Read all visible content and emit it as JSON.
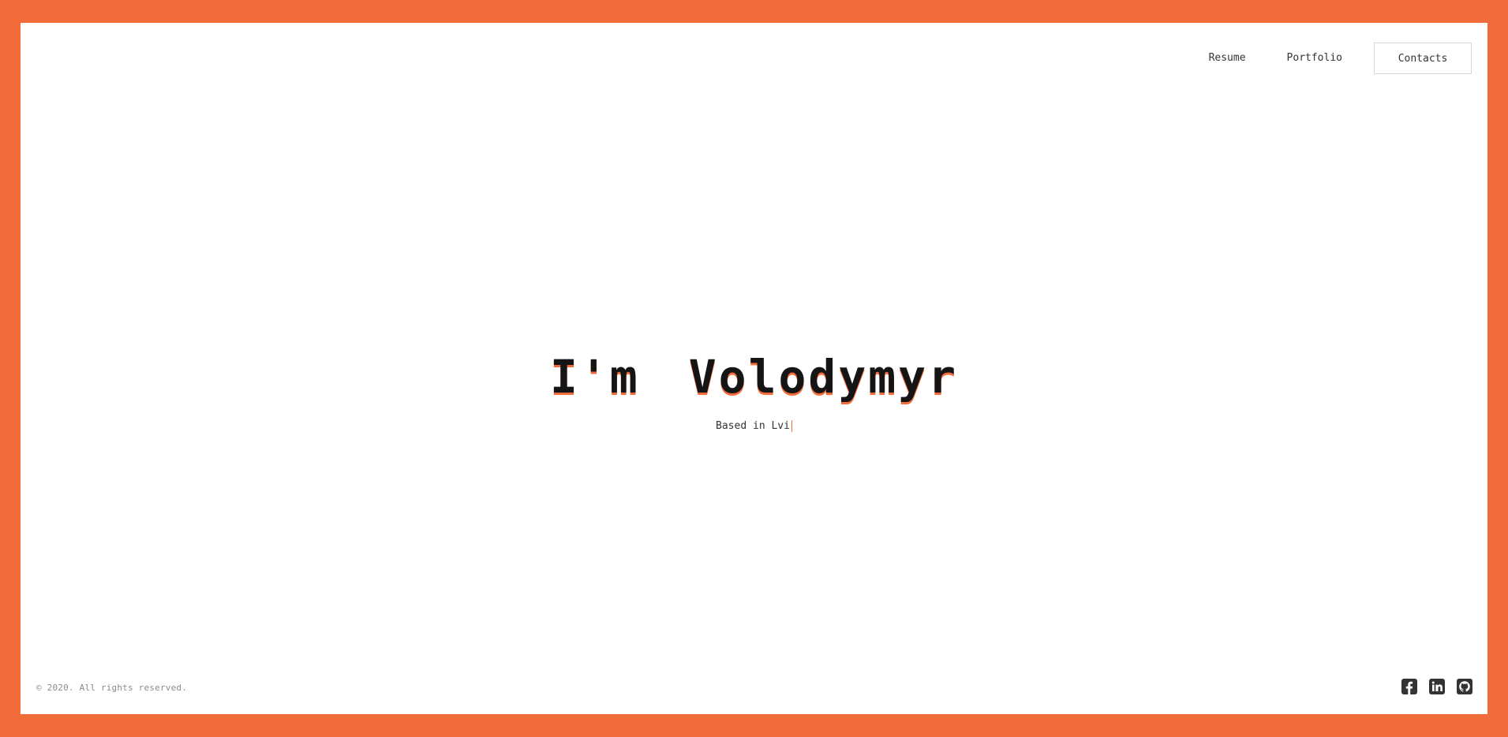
{
  "nav": {
    "items": [
      {
        "label": "Resume"
      },
      {
        "label": "Portfolio"
      }
    ],
    "contacts_label": "Contacts"
  },
  "hero": {
    "title_parts": [
      "I'm",
      "Volodymyr"
    ],
    "subtitle": "Based in Lvi"
  },
  "footer": {
    "copyright": "© 2020. All rights reserved."
  },
  "social": {
    "icons": [
      "facebook-icon",
      "linkedin-icon",
      "github-icon"
    ]
  },
  "colors": {
    "accent": "#f26b3a",
    "text": "#151515",
    "muted": "#8b8b8b",
    "icon": "#333333"
  }
}
